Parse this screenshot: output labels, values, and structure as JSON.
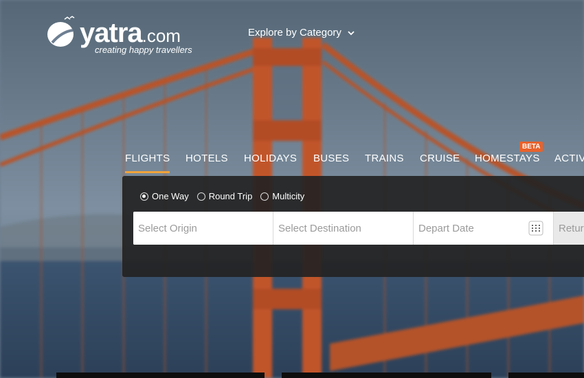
{
  "header": {
    "logo_word": "yatra",
    "logo_domain": ".com",
    "tagline": "creating happy travellers",
    "explore_label": "Explore by Category"
  },
  "tabs": [
    {
      "label": "FLIGHTS",
      "active": true
    },
    {
      "label": "HOTELS",
      "active": false
    },
    {
      "label": "HOLIDAYS",
      "active": false
    },
    {
      "label": "BUSES",
      "active": false
    },
    {
      "label": "TRAINS",
      "active": false
    },
    {
      "label": "CRUISE",
      "active": false
    },
    {
      "label": "HOMESTAYS",
      "active": false
    },
    {
      "label": "ACTIV",
      "active": false
    }
  ],
  "beta_badge": "BETA",
  "trip_types": [
    {
      "label": "One Way",
      "selected": true
    },
    {
      "label": "Round Trip",
      "selected": false
    },
    {
      "label": "Multicity",
      "selected": false
    }
  ],
  "search": {
    "origin_placeholder": "Select Origin",
    "destination_placeholder": "Select Destination",
    "depart_placeholder": "Depart Date",
    "return_placeholder": "Return"
  },
  "colors": {
    "tab_active_underline": "#f0a33a",
    "beta_badge": "#e8622c",
    "panel": "#232323"
  },
  "icons": {
    "chevron": "chevron-down-icon",
    "calendar": "calendar-icon",
    "logo": "yatra-logo-icon"
  }
}
